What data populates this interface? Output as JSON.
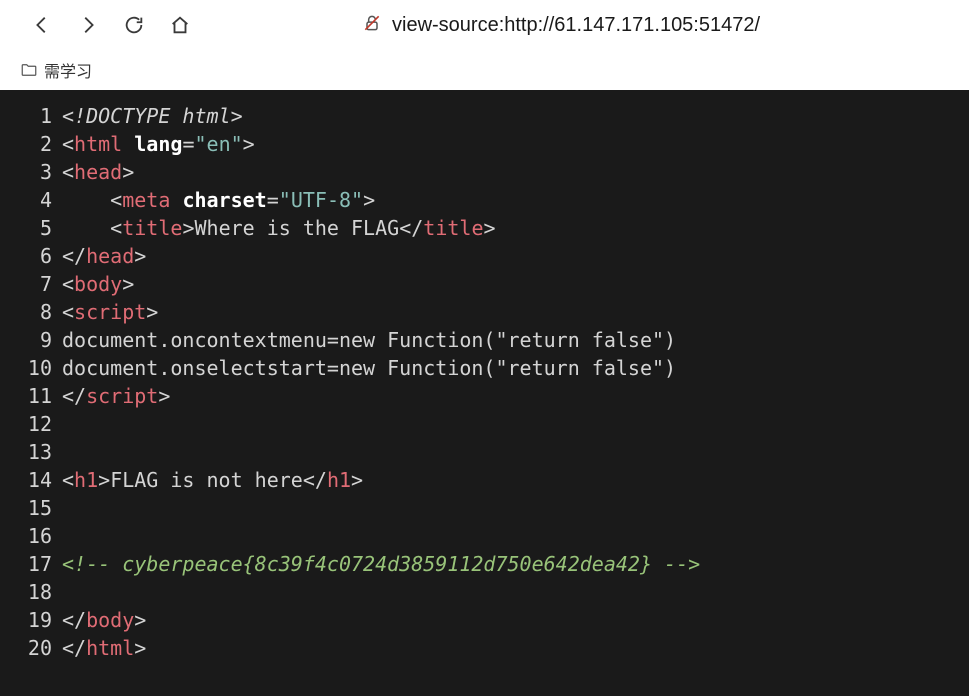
{
  "toolbar": {
    "url": "view-source:http://61.147.171.105:51472/"
  },
  "bookmarks": {
    "item1": "需学习"
  },
  "source": {
    "lines": [
      {
        "n": "1"
      },
      {
        "n": "2"
      },
      {
        "n": "3"
      },
      {
        "n": "4"
      },
      {
        "n": "5"
      },
      {
        "n": "6"
      },
      {
        "n": "7"
      },
      {
        "n": "8"
      },
      {
        "n": "9"
      },
      {
        "n": "10"
      },
      {
        "n": "11"
      },
      {
        "n": "12"
      },
      {
        "n": "13"
      },
      {
        "n": "14"
      },
      {
        "n": "15"
      },
      {
        "n": "16"
      },
      {
        "n": "17"
      },
      {
        "n": "18"
      },
      {
        "n": "19"
      },
      {
        "n": "20"
      }
    ],
    "tokens": {
      "doctype": "<!DOCTYPE html>",
      "html": "html",
      "lang": "lang",
      "langval": "\"en\"",
      "head": "head",
      "meta": "meta",
      "charset": "charset",
      "charsetval": "\"UTF-8\"",
      "title": "title",
      "titleText": "Where is the FLAG",
      "body": "body",
      "script": "script",
      "js1": "document.oncontextmenu=new Function(\"return false\")",
      "js2": "document.onselectstart=new Function(\"return false\")",
      "h1": "h1",
      "h1text": "FLAG is not here",
      "comment": "<!-- cyberpeace{8c39f4c0724d3859112d750e642dea42} -->"
    }
  }
}
